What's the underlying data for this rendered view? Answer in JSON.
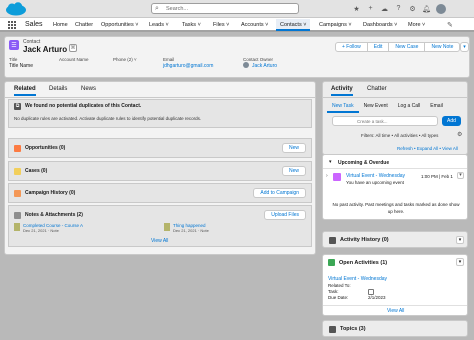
{
  "topbar": {
    "search_placeholder": "Search..."
  },
  "nav": {
    "app_name": "Sales",
    "items": [
      {
        "label": "Home",
        "active": false
      },
      {
        "label": "Chatter",
        "active": false
      },
      {
        "label": "Opportunities ˅",
        "active": false
      },
      {
        "label": "Leads ˅",
        "active": false
      },
      {
        "label": "Tasks ˅",
        "active": false
      },
      {
        "label": "Files ˅",
        "active": false
      },
      {
        "label": "Accounts ˅",
        "active": false
      },
      {
        "label": "Contacts ˅",
        "active": true
      },
      {
        "label": "Campaigns ˅",
        "active": false
      },
      {
        "label": "Dashboards ˅",
        "active": false
      },
      {
        "label": "More ˅",
        "active": false
      }
    ]
  },
  "record": {
    "object": "Contact",
    "name": "Jack Arturo",
    "actions": [
      "+ Follow",
      "Edit",
      "New Case",
      "New Note"
    ],
    "fields": [
      {
        "label": "Title",
        "value": "Title Name",
        "link": false
      },
      {
        "label": "Account Name",
        "value": "",
        "link": false
      },
      {
        "label": "Phone (2) ˅",
        "value": "",
        "link": false
      },
      {
        "label": "Email",
        "value": "jdhgarturo@gmail.com",
        "link": true
      },
      {
        "label": "Contact Owner",
        "value": "Jack Arturo",
        "link": true
      }
    ]
  },
  "left": {
    "tabs": [
      "Related",
      "Details",
      "News"
    ],
    "duplicate_title": "We found no potential duplicates of this Contact.",
    "duplicate_body": "No duplicate rules are activated. Activate duplicate rules to identify potential duplicate records.",
    "related_lists": [
      {
        "title": "Opportunities (0)",
        "button": "New"
      },
      {
        "title": "Cases (0)",
        "button": "New"
      },
      {
        "title": "Campaign History (0)",
        "button": "Add to Campaign"
      },
      {
        "title": "Notes & Attachments (2)",
        "button": "Upload Files"
      }
    ],
    "notes": [
      {
        "title": "Completed Course - Course A",
        "meta": "Dec 21, 2021 · Note"
      },
      {
        "title": "Thing happened",
        "meta": "Dec 21, 2021 · Note"
      }
    ],
    "view_all": "View All"
  },
  "activity": {
    "tabs": [
      "Activity",
      "Chatter"
    ],
    "quick_actions": [
      "New Task",
      "New Event",
      "Log a Call",
      "Email"
    ],
    "task_placeholder": "Create a task...",
    "add_label": "Add",
    "filters": "Filters: All time • All activities • All types",
    "links": "Refresh • Expand All • View All",
    "section_title": "Upcoming & Overdue",
    "event_title": "Virtual Event - Wednesday",
    "event_time": "1:00 PM | Feb 1",
    "event_desc": "You have an upcoming event",
    "no_past": "No past activity. Past meetings and tasks marked as done show up here."
  },
  "history": {
    "title": "Activity History (0)"
  },
  "open_activities": {
    "title": "Open Activities (1)",
    "event": "Virtual Event - Wednesday",
    "related_to_label": "Related To:",
    "task_label": "Task:",
    "due_label": "Due Date:",
    "due_value": "2/1/2023",
    "view_all": "View All"
  },
  "topics": {
    "title": "Topics (3)"
  }
}
